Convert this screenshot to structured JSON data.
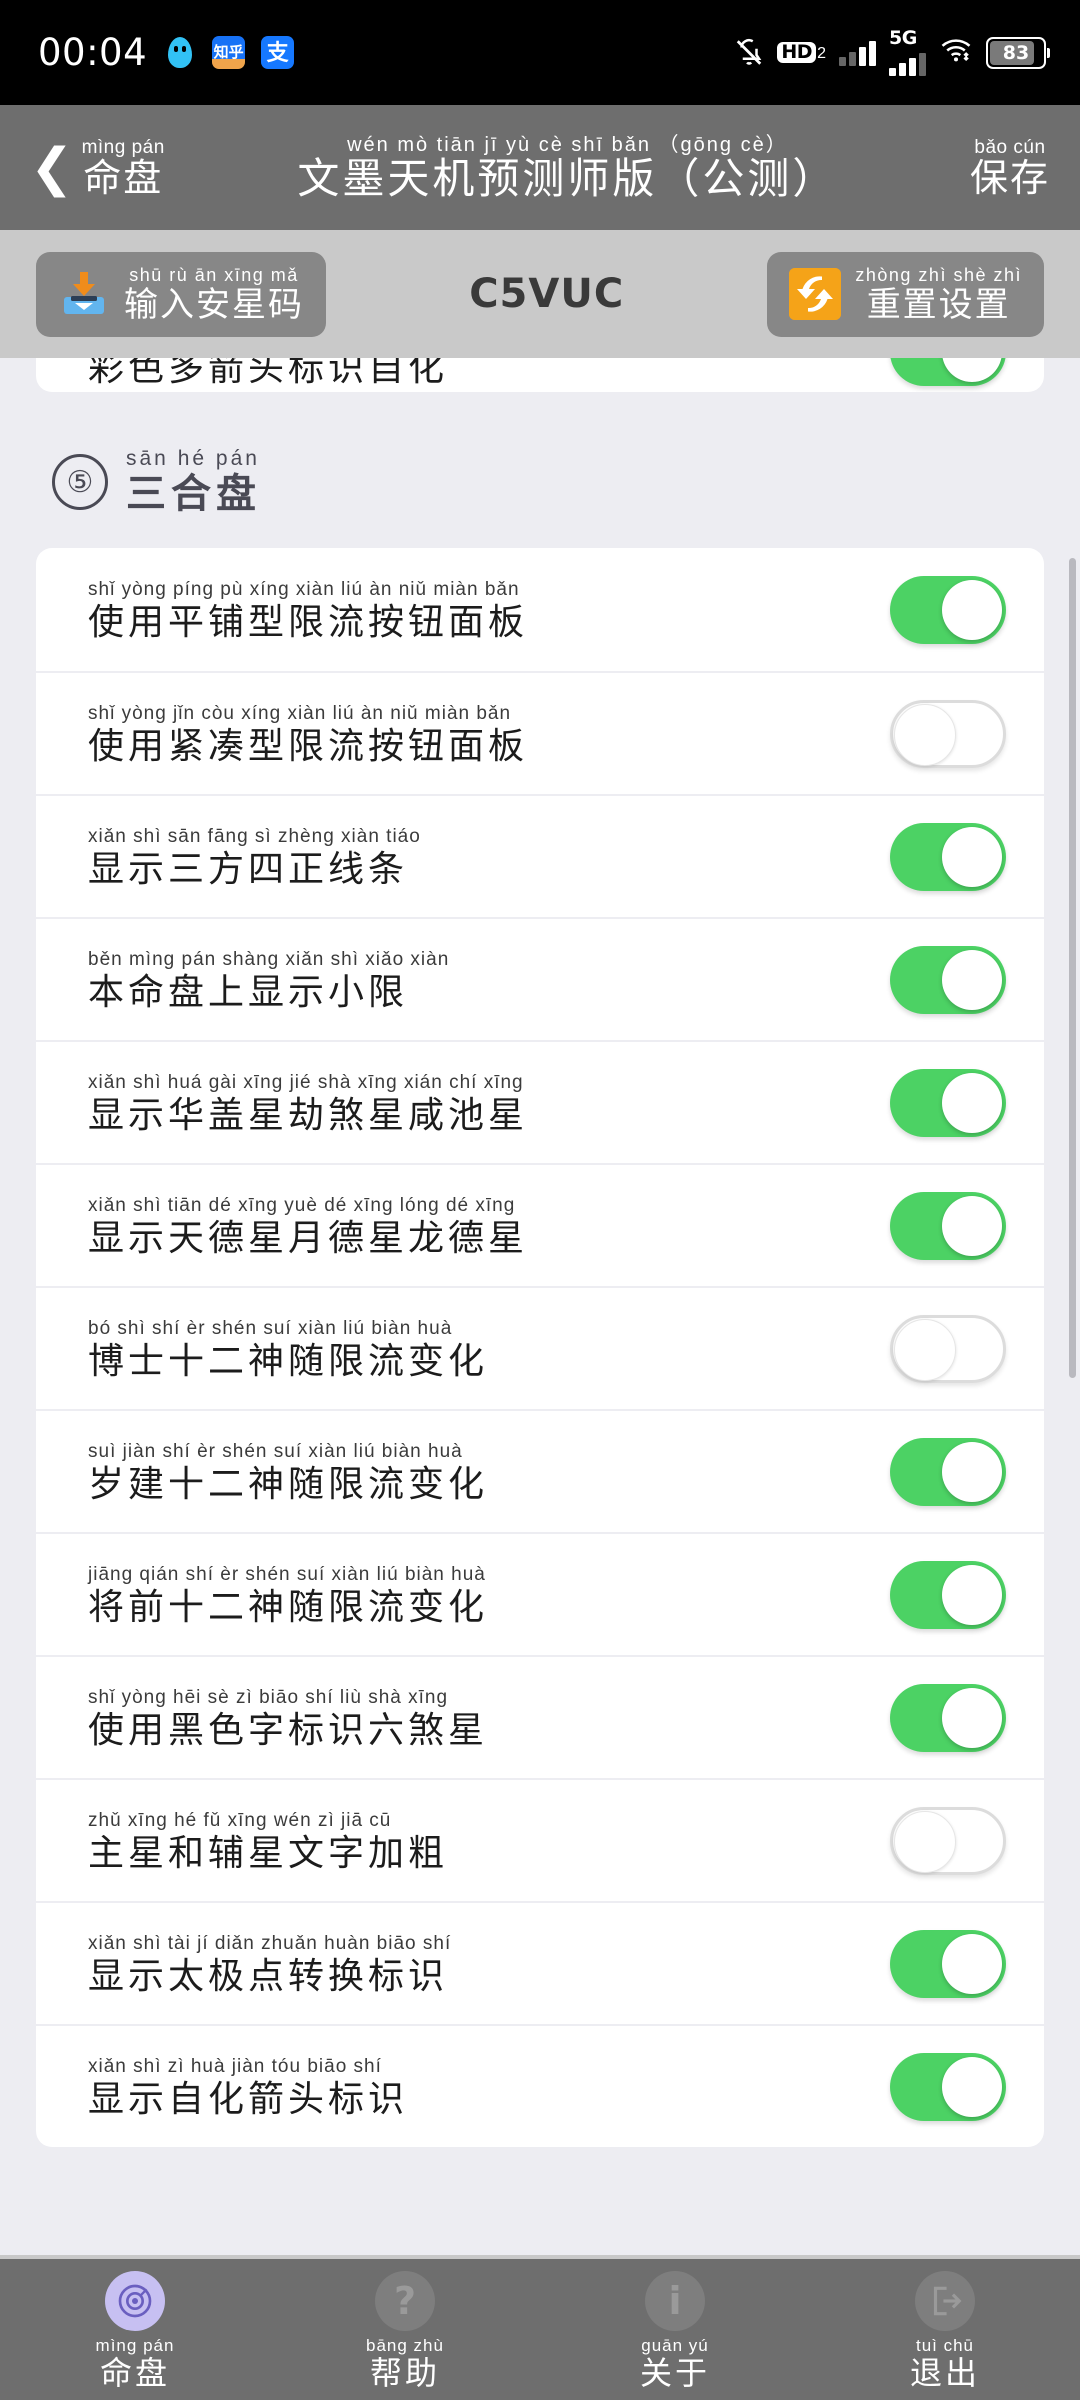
{
  "status_bar": {
    "time": "00:04",
    "app_icons": [
      {
        "name": "qq-icon",
        "glyph": ""
      },
      {
        "name": "zhihu-icon",
        "glyph": "知乎"
      },
      {
        "name": "alipay-icon",
        "glyph": "支"
      }
    ],
    "mute_icon": "bell-off-icon",
    "hd_label": "HD",
    "hd_sub": "2",
    "network_label": "5G",
    "wifi_icon": "wifi-icon",
    "battery_level": "83"
  },
  "header": {
    "back_icon": "chevron-left-icon",
    "back_pinyin": "mìng pán",
    "back_label": "命盘",
    "title_pinyin": "wén mò tiān jī  yù cè shī bǎn   （gōng cè）",
    "title_pinyin_parts": [
      "wén",
      "mò",
      "tiān",
      "jī",
      "yù",
      "cè",
      "shī",
      "bǎn",
      "gōng",
      "cè"
    ],
    "title": "文墨天机预测师版（公测）",
    "save_pinyin": "bǎo cún",
    "save_label": "保存"
  },
  "toolbar": {
    "import_icon": "import-download-icon",
    "import_pinyin": "shū rù ān xīng mǎ",
    "import_label": "输入安星码",
    "code": "C5VUC",
    "reset_icon": "reset-swap-icon",
    "reset_pinyin": "zhòng zhì shè zhì",
    "reset_label": "重置设置"
  },
  "clipped_row": {
    "label": "彩色多箭头标识自化",
    "toggle": "on"
  },
  "section": {
    "number": "⑤",
    "pinyin": "sān hé pán",
    "label": "三合盘"
  },
  "settings_rows": [
    {
      "pinyin": "shǐ yòng píng pù xíng xiàn liú  àn  niǔ miàn bǎn",
      "label": "使用平铺型限流按钮面板",
      "toggle": "on"
    },
    {
      "pinyin": "shǐ yòng jǐn còu xíng xiàn liú  àn  niǔ miàn bǎn",
      "label": "使用紧凑型限流按钮面板",
      "toggle": "off"
    },
    {
      "pinyin": "xiǎn shì sān fāng  sì  zhèng xiàn tiáo",
      "label": "显示三方四正线条",
      "toggle": "on"
    },
    {
      "pinyin": "běn mìng pán shàng xiǎn  shì  xiǎo xiàn",
      "label": "本命盘上显示小限",
      "toggle": "on"
    },
    {
      "pinyin": "xiǎn shì huá gài xīng jié  shà xīng xián chí xīng",
      "label": "显示华盖星劫煞星咸池星",
      "toggle": "on"
    },
    {
      "pinyin": "xiǎn shì tiān dé xīng yuè  dé xīng lóng  dé xīng",
      "label": "显示天德星月德星龙德星",
      "toggle": "on"
    },
    {
      "pinyin": "bó  shì  shí  èr  shén suí xiàn liú biàn huà",
      "label": "博士十二神随限流变化",
      "toggle": "off"
    },
    {
      "pinyin": "suì jiàn shí  èr  shén suí xiàn liú biàn huà",
      "label": "岁建十二神随限流变化",
      "toggle": "on"
    },
    {
      "pinyin": "jiāng qián shí  èr  shén suí xiàn liú biàn huà",
      "label": "将前十二神随限流变化",
      "toggle": "on"
    },
    {
      "pinyin": "shǐ yòng hēi  sè   zì  biāo shí  liù  shà xīng",
      "label": "使用黑色字标识六煞星",
      "toggle": "on"
    },
    {
      "pinyin": "zhǔ xīng hé  fǔ xīng wén  zì  jiā  cū",
      "label": "主星和辅星文字加粗",
      "toggle": "off"
    },
    {
      "pinyin": "xiǎn shì tài  jí  diǎn zhuǎn huàn biāo shí",
      "label": "显示太极点转换标识",
      "toggle": "on"
    },
    {
      "pinyin": "xiǎn shì  zì  huà jiàn tóu biāo shí",
      "label": "显示自化箭头标识",
      "toggle": "on"
    }
  ],
  "bottom_nav": [
    {
      "icon": "compass-chart-icon",
      "pinyin": "mìng pán",
      "label": "命盘",
      "active": true
    },
    {
      "icon": "question-help-icon",
      "pinyin": "bāng zhù",
      "label": "帮助",
      "active": false
    },
    {
      "icon": "info-icon",
      "pinyin": "guān yú",
      "label": "关于",
      "active": false
    },
    {
      "icon": "exit-logout-icon",
      "pinyin": "tuì chū",
      "label": "退出",
      "active": false
    }
  ],
  "colors": {
    "toggle_on": "#4CD264",
    "accent_orange": "#f5a318",
    "header_gray": "#6e6e6e",
    "page_bg": "#ededf2"
  }
}
